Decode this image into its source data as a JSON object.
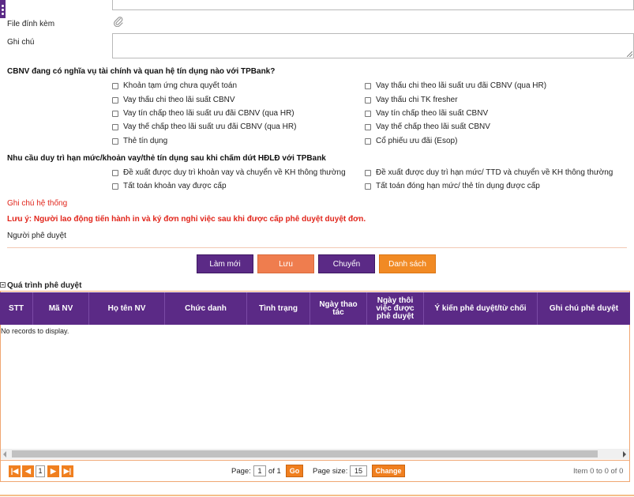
{
  "fields": {
    "attachment_label": "File đính kèm",
    "note_label": "Ghi chú"
  },
  "section1": {
    "title": "CBNV đang có nghĩa vụ tài chính và quan hệ tín dụng nào với TPBank?",
    "left": [
      "Khoản tạm ứng chưa quyết toán",
      "Vay thấu chi theo lãi suất CBNV",
      "Vay tín chấp theo lãi suất ưu đãi CBNV (qua HR)",
      "Vay thế chấp theo lãi suất ưu đãi CBNV (qua HR)",
      "Thẻ tín dụng"
    ],
    "right": [
      "Vay thấu chi theo lãi suất ưu đãi CBNV (qua HR)",
      "Vay thấu chi TK fresher",
      "Vay tín chấp theo lãi suất CBNV",
      "Vay thế chấp theo lãi suất CBNV",
      "Cổ phiếu ưu đãi (Esop)"
    ]
  },
  "section2": {
    "title": "Nhu cầu duy trì hạn mức/khoản vay/thẻ tín dụng sau khi chấm dứt HĐLĐ với TPBank",
    "left": [
      "Đề xuất được duy trì khoản vay và chuyển về KH thông thường",
      "Tất toán khoản vay được cấp"
    ],
    "right": [
      "Đề xuất được duy trì hạn mức/ TTD và chuyển về KH thông thường",
      "Tất toán đóng hạn mức/ thẻ tín dụng được cấp"
    ]
  },
  "system_note": "Ghi chú hệ thống",
  "warning": "Lưu ý: Người lao động tiến hành in và ký đơn nghỉ việc sau khi được cấp phê duyệt duyệt đơn.",
  "approver_label": "Người phê duyệt",
  "buttons": {
    "refresh": "Làm mới",
    "save": "Lưu",
    "forward": "Chuyển",
    "list": "Danh sách"
  },
  "approval": {
    "title": "Quá trình phê duyệt",
    "columns": [
      "STT",
      "Mã NV",
      "Họ tên NV",
      "Chức danh",
      "Tình trạng",
      "Ngày thao tác",
      "Ngày thôi việc được phê duyệt",
      "Ý kiến phê duyệt/từ chối",
      "Ghi chú phê duyệt"
    ],
    "empty": "No records to display."
  },
  "pager": {
    "current_page": "1",
    "page_label": "Page:",
    "page_value": "1",
    "of_label": "of 1",
    "go": "Go",
    "size_label": "Page size:",
    "size_value": "15",
    "change": "Change",
    "summary": "Item 0 to 0 of 0"
  },
  "icons": {
    "attachment": "paperclip-icon",
    "collapse": "minus-box-icon",
    "first": "first-page-icon",
    "prev": "prev-page-icon",
    "next": "next-page-icon",
    "last": "last-page-icon"
  },
  "colors": {
    "primary": "#5b2a86",
    "accent": "#ef7d4e",
    "orange": "#f18a24",
    "warning": "#e1251b"
  }
}
